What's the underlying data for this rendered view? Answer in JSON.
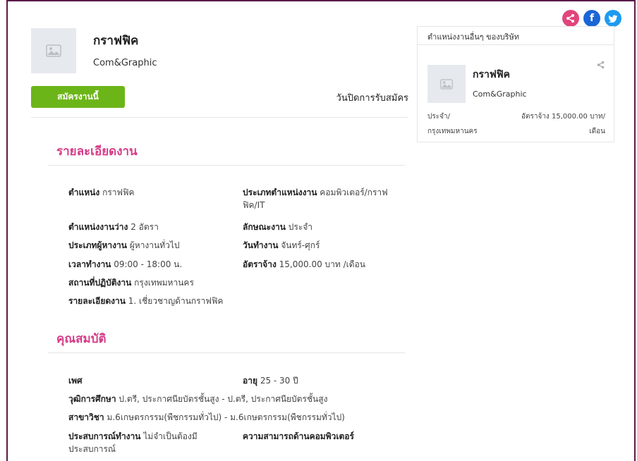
{
  "job": {
    "title": "กราฟฟิค",
    "company": "Com&Graphic",
    "apply_label": "สมัครงานนี้",
    "close_date_label": "วันปิดการรับสมัคร"
  },
  "details": {
    "title": "รายละเอียดงาน",
    "position_label": "ตำแหน่ง",
    "position_value": "กราฟฟิค",
    "category_label": "ประเภทตำแหน่งงาน",
    "category_value_1": "คอมพิวเตอร์/กราฟ",
    "category_value_2": "ฟิค/IT",
    "vacancy_label": "ตำแหน่งงานว่าง",
    "vacancy_value": "2 อัตรา",
    "nature_label": "ลักษณะงาน",
    "nature_value": "ประจำ",
    "applicant_label": "ประเภทผู้หางาน",
    "applicant_value": "ผู้หางานทั่วไป",
    "workdays_label": "วันทำงาน",
    "workdays_value": "จันทร์-ศุกร์",
    "hours_label": "เวลาทำงาน",
    "hours_value": "09:00 - 18:00 น.",
    "salary_label": "อัตราจ้าง",
    "salary_value": "15,000.00 บาท /เดือน",
    "location_label": "สถานที่ปฏิบัติงาน",
    "location_value": "กรุงเทพมหานคร",
    "desc_label": "รายละเอียดงาน",
    "desc_value": "1. เชี่ยวชาญด้านกราฟฟิค"
  },
  "qualifications": {
    "title": "คุณสมบัติ",
    "gender_label": "เพศ",
    "age_label": "อายุ",
    "age_value": "25 - 30 ปี",
    "education_label": "วุฒิการศึกษา",
    "education_value": "ป.ตรี, ประกาศนียบัตรชั้นสูง - ป.ตรี, ประกาศนียบัตรชั้นสูง",
    "major_label": "สาขาวิชา",
    "major_value": "ม.6เกษตรกรรม(พืชกรรมทั่วไป) - ม.6เกษตรกรรม(พืชกรรมทั่วไป)",
    "experience_label": "ประสบการณ์ทำงาน",
    "experience_value_1": "ไม่จำเป็นต้องมี",
    "experience_value_2": "ประสบการณ์",
    "computer_label": "ความสามารถด้านคอมพิวเตอร์"
  },
  "sidebar": {
    "heading": "ตำแหน่งงานอื่นๆ ของบริษัท",
    "title": "กราฟฟิค",
    "company": "Com&Graphic",
    "type_1": "ประจำ/",
    "type_2": "กรุงเทพมหานคร",
    "salary_1": "อัตราจ้าง 15,000.00 บาท/",
    "salary_2": "เดือน"
  },
  "colors": {
    "accent": "#d63c88",
    "apply": "#6cb518",
    "share": "#e0457b",
    "facebook": "#1a66d6",
    "twitter": "#1d9bf0"
  }
}
